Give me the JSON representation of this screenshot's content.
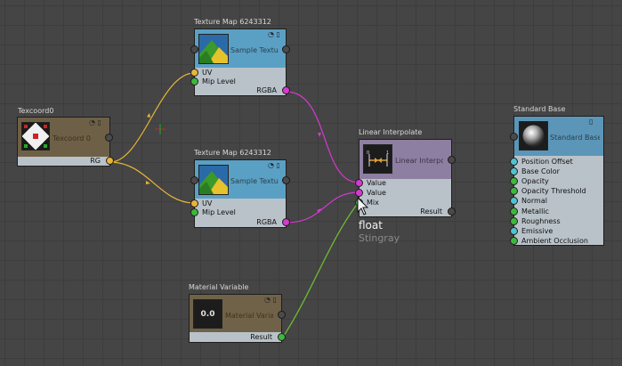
{
  "nodes": {
    "texcoord": {
      "title": "Texcoord0",
      "label": "Texcoord 0",
      "pins": {
        "out": "RG"
      }
    },
    "texmap_top": {
      "title": "Texture Map 6243312",
      "label": "Sample Texture",
      "pins": {
        "uv": "UV",
        "mip": "Mip Level",
        "out": "RGBA"
      }
    },
    "texmap_bottom": {
      "title": "Texture Map 6243312",
      "label": "Sample Texture",
      "pins": {
        "uv": "UV",
        "mip": "Mip Level",
        "out": "RGBA"
      }
    },
    "lerp": {
      "title": "Linear Interpolate",
      "label": "Linear Interpolate",
      "pins": {
        "value1": "Value",
        "value2": "Value",
        "mix": "Mix",
        "out": "Result"
      }
    },
    "material_variable": {
      "title": "Material Variable",
      "label": "Material Variable",
      "value": "0.0",
      "pins": {
        "out": "Result"
      }
    },
    "standard_base": {
      "title": "Standard Base",
      "label": "Standard Base",
      "inputs": [
        {
          "label": "Position Offset",
          "color": "#4fc3d0"
        },
        {
          "label": "Base Color",
          "color": "#4fc3d0"
        },
        {
          "label": "Opacity",
          "color": "#3cb83c"
        },
        {
          "label": "Opacity Threshold",
          "color": "#3cb83c"
        },
        {
          "label": "Normal",
          "color": "#4fc3d0"
        },
        {
          "label": "Metallic",
          "color": "#3cb83c"
        },
        {
          "label": "Roughness",
          "color": "#3cb83c"
        },
        {
          "label": "Emissive",
          "color": "#4fc3d0"
        },
        {
          "label": "Ambient Occlusion",
          "color": "#3cb83c"
        }
      ]
    }
  },
  "tooltip": {
    "type": "float",
    "source": "Stingray"
  },
  "colors": {
    "uv_wire": "#e7b537",
    "rgba_wire": "#d43ad0",
    "float_wire": "#6fc22f",
    "texture_header": "#5aa0c4",
    "texcoord_header": "#6e6046",
    "lerp_header": "#8d7fa1",
    "variable_header": "#6f6248",
    "standard_header": "#5b96b8"
  }
}
